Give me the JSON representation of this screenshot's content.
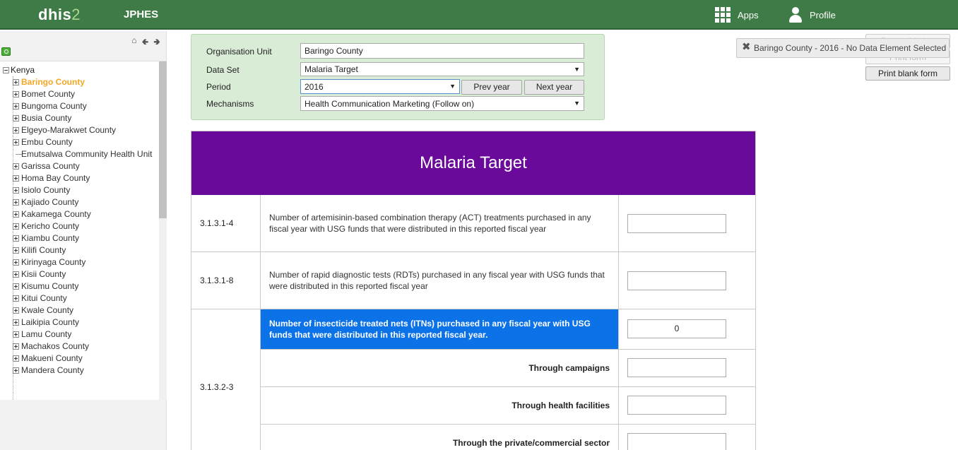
{
  "header": {
    "logo_main": "dhis",
    "logo_num": "2",
    "app_title": "JPHES",
    "apps_label": "Apps",
    "profile_label": "Profile"
  },
  "sidebar": {
    "root": "Kenya",
    "items": [
      {
        "label": "Baringo County",
        "selected": true
      },
      {
        "label": "Bomet County"
      },
      {
        "label": "Bungoma County"
      },
      {
        "label": "Busia County"
      },
      {
        "label": "Elgeyo-Marakwet County"
      },
      {
        "label": "Embu County"
      },
      {
        "label": "Emutsalwa Community Health Unit",
        "leaf": true
      },
      {
        "label": "Garissa County"
      },
      {
        "label": "Homa Bay County"
      },
      {
        "label": "Isiolo County"
      },
      {
        "label": "Kajiado County"
      },
      {
        "label": "Kakamega County"
      },
      {
        "label": "Kericho County"
      },
      {
        "label": "Kiambu County"
      },
      {
        "label": "Kilifi County"
      },
      {
        "label": "Kirinyaga County"
      },
      {
        "label": "Kisii County"
      },
      {
        "label": "Kisumu County"
      },
      {
        "label": "Kitui County"
      },
      {
        "label": "Kwale County"
      },
      {
        "label": "Laikipia County"
      },
      {
        "label": "Lamu County"
      },
      {
        "label": "Machakos County"
      },
      {
        "label": "Makueni County"
      },
      {
        "label": "Mandera County"
      }
    ]
  },
  "selection": {
    "org_unit_label": "Organisation Unit",
    "org_unit_value": "Baringo County",
    "dataset_label": "Data Set",
    "dataset_value": "Malaria Target",
    "period_label": "Period",
    "period_value": "2016",
    "prev_year": "Prev year",
    "next_year": "Next year",
    "mechanisms_label": "Mechanisms",
    "mechanisms_value": "Health Communication Marketing (Follow on)"
  },
  "actions": {
    "run_validation": "Run validation",
    "print_form": "Print form",
    "print_blank_form": "Print blank form"
  },
  "notification": "Baringo County - 2016 - No Data Element Selected",
  "form": {
    "title": "Malaria Target",
    "rows": [
      {
        "code": "3.1.3.1-4",
        "description": "Number of artemisinin-based combination therapy (ACT) treatments purchased in any fiscal year with USG funds that were distributed in this reported fiscal year",
        "value": ""
      },
      {
        "code": "3.1.3.1-8",
        "description": "Number of rapid diagnostic tests (RDTs) purchased in any fiscal year with USG funds that were distributed in this reported fiscal year",
        "value": ""
      },
      {
        "code": "3.1.3.2-3",
        "description": "Number of insecticide treated nets (ITNs) purchased in any fiscal year with USG funds that were distributed in this reported fiscal year.",
        "value": "0",
        "sub_rows": [
          {
            "label": "Through campaigns",
            "value": ""
          },
          {
            "label": "Through health facilities",
            "value": ""
          },
          {
            "label": "Through the private/commercial sector",
            "value": ""
          }
        ]
      }
    ]
  }
}
